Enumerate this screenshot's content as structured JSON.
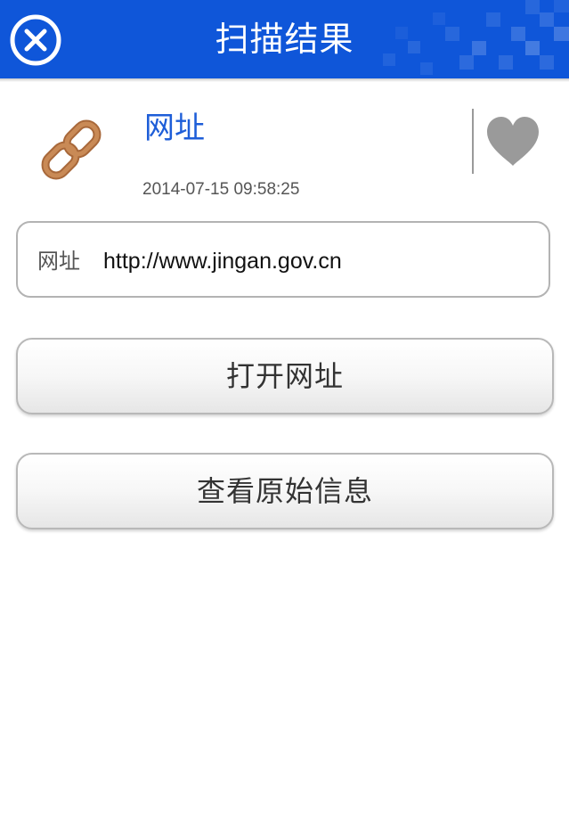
{
  "header": {
    "title": "扫描结果",
    "close_icon": "close-circle-icon",
    "background_color": "#0f56d9"
  },
  "result": {
    "type_icon": "chain-link-icon",
    "type_label": "网址",
    "timestamp": "2014-07-15 09:58:25",
    "favorite_icon": "heart-icon",
    "accent_color": "#1e5ed8"
  },
  "url_field": {
    "label": "网址",
    "value": "http://www.jingan.gov.cn"
  },
  "actions": {
    "open_url_label": "打开网址",
    "view_raw_label": "查看原始信息"
  }
}
